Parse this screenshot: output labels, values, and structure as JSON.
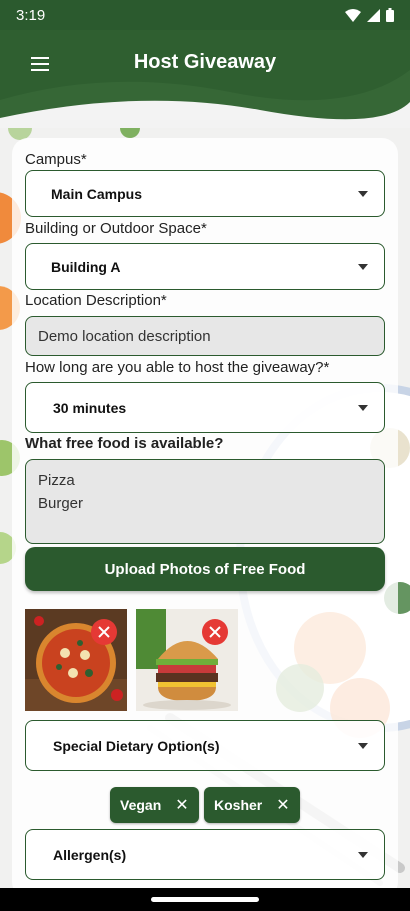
{
  "status": {
    "time": "3:19"
  },
  "appbar": {
    "title": "Host Giveaway"
  },
  "form": {
    "campus": {
      "label": "Campus*",
      "value": "Main Campus"
    },
    "building": {
      "label": "Building or Outdoor Space*",
      "value": "Building A"
    },
    "location": {
      "label": "Location Description*",
      "value": "Demo location description"
    },
    "duration": {
      "label": "How long are you able to host the giveaway?*",
      "value": "30 minutes"
    },
    "food": {
      "label": "What free food is available?",
      "lines": [
        "Pizza",
        "Burger"
      ]
    },
    "upload_label": "Upload Photos of Free Food",
    "photos": [
      {
        "name": "pizza"
      },
      {
        "name": "burger"
      }
    ],
    "dietary": {
      "placeholder": "Special Dietary Option(s)",
      "chips": [
        "Vegan",
        "Kosher"
      ]
    },
    "allergen": {
      "placeholder": "Allergen(s)"
    }
  },
  "colors": {
    "primary": "#2b5a2e",
    "remove": "#e53935"
  }
}
